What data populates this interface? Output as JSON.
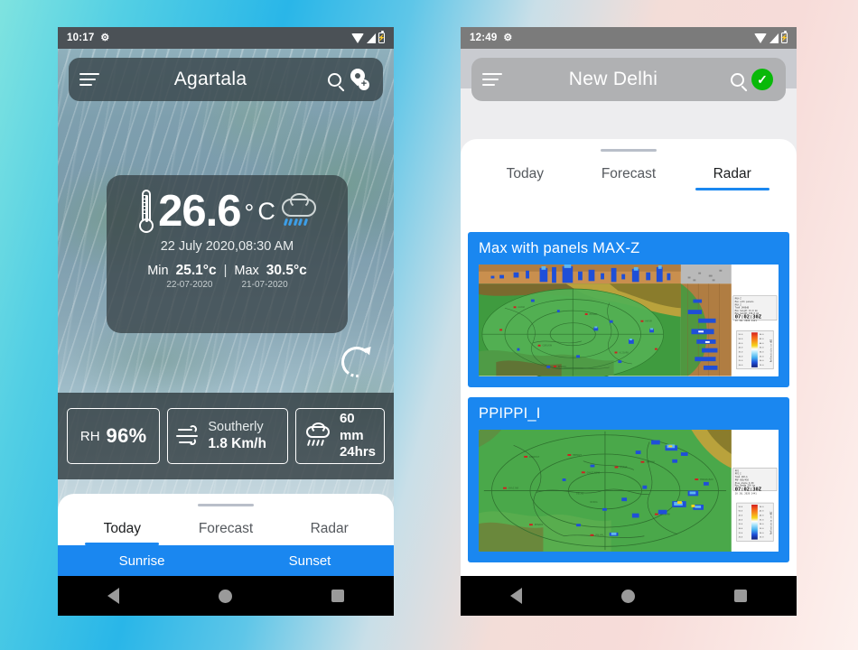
{
  "colors": {
    "accent_blue": "#1a87f0",
    "status_green": "#09b909",
    "statusbar_left": "#4b5156",
    "statusbar_right": "#7b7b7b",
    "card_overlay": "rgba(52,62,66,.74)"
  },
  "left_phone": {
    "status_bar": {
      "time": "10:17",
      "gear_icon": "gear-icon",
      "wifi_icon": "wifi-icon",
      "signal_icon": "signal-icon",
      "battery_icon": "battery-icon"
    },
    "appbar": {
      "menu_icon": "hamburger-menu-icon",
      "title": "Agartala",
      "search_icon": "search-icon",
      "add_location_icon": "add-location-pin-icon"
    },
    "temp_card": {
      "thermometer_icon": "thermometer-icon",
      "temperature": "26.6",
      "degree_symbol": "°",
      "unit": "C",
      "weather_icon": "cloud-rain-icon",
      "datetime": "22 July 2020,08:30 AM",
      "min_label": "Min",
      "min_value": "25.1°c",
      "divider": "|",
      "max_label": "Max",
      "max_value": "30.5°c",
      "min_date": "22-07-2020",
      "max_date": "21-07-2020"
    },
    "refresh_icon": "refresh-icon",
    "metrics": [
      {
        "icon": "",
        "label": "RH",
        "value": "96%",
        "kind": "rh"
      },
      {
        "icon": "wind-icon",
        "top": "Southerly",
        "bottom": "1.8 Km/h",
        "kind": "wind"
      },
      {
        "icon": "rain-cloud-icon",
        "top": "60 mm",
        "bottom": "24hrs",
        "kind": "rain"
      }
    ],
    "tabs": [
      {
        "label": "Today",
        "active": true
      },
      {
        "label": "Forecast",
        "active": false
      },
      {
        "label": "Radar",
        "active": false
      }
    ],
    "sun_bar": {
      "sunrise": "Sunrise",
      "sunset": "Sunset"
    },
    "nav_bar": {
      "back_icon": "back-triangle-icon",
      "home_icon": "home-circle-icon",
      "recents_icon": "recents-square-icon"
    }
  },
  "right_phone": {
    "status_bar": {
      "time": "12:49",
      "gear_icon": "gear-icon",
      "wifi_icon": "wifi-icon",
      "signal_icon": "signal-icon",
      "battery_icon": "battery-icon"
    },
    "appbar": {
      "menu_icon": "hamburger-menu-icon",
      "title": "New Delhi",
      "search_icon": "search-icon",
      "check_icon": "green-check-badge-icon"
    },
    "tabs": [
      {
        "label": "Today",
        "active": false
      },
      {
        "label": "Forecast",
        "active": false
      },
      {
        "label": "Radar",
        "active": true
      }
    ],
    "radar_cards": [
      {
        "title": "Max with panels MAX-Z",
        "image_name": "radar-max-z-panels-image",
        "timestamp": "07:02:30Z",
        "date": "10 JUL 2020 1441"
      },
      {
        "title": "PPIPPI_I",
        "image_name": "radar-ppi-image",
        "timestamp": "07:02:30Z",
        "date": "10 JUL 2020 1441"
      }
    ],
    "nav_bar": {
      "back_icon": "back-triangle-icon",
      "home_icon": "home-circle-icon",
      "recents_icon": "recents-square-icon"
    }
  }
}
